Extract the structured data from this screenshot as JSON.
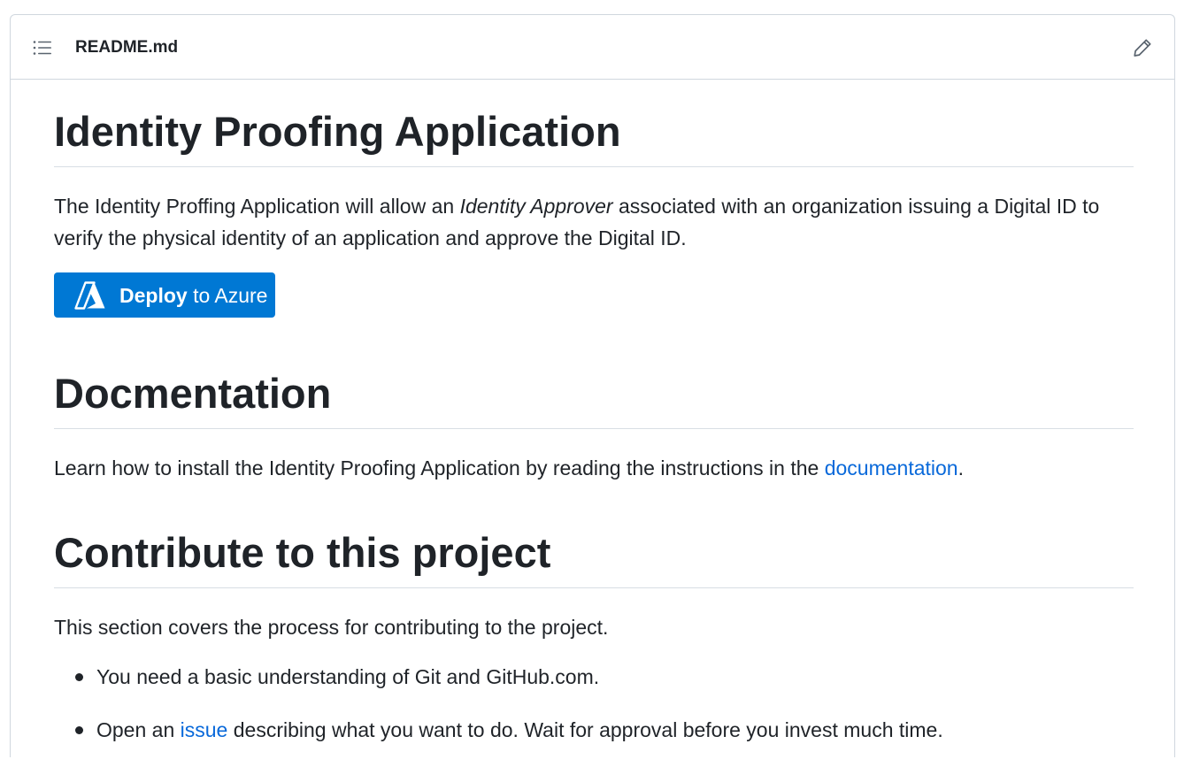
{
  "header": {
    "file_name": "README.md",
    "toc_icon": "list-unordered-icon",
    "edit_icon": "pencil-icon"
  },
  "content": {
    "title": "Identity Proofing Application",
    "intro": {
      "before": "The Identity Proffing Application will allow an ",
      "emphasis": "Identity Approver",
      "after": " associated with an organization issuing a Digital ID to verify the physical identity of an application and approve the Digital ID."
    },
    "deploy_button": {
      "strong": "Deploy",
      "rest": " to Azure",
      "icon": "azure-logo-icon",
      "background": "#0078d4"
    },
    "docs_heading": "Docmentation",
    "docs_paragraph": {
      "before": "Learn how to install the Identity Proofing Application by reading the instructions in the ",
      "link": "documentation",
      "after": "."
    },
    "contrib_heading": "Contribute to this project",
    "contrib_paragraph": "This section covers the process for contributing to the project.",
    "contrib_list": [
      {
        "text": "You need a basic understanding of Git and GitHub.com."
      },
      {
        "before": "Open an ",
        "link": "issue",
        "after": " describing what you want to do. Wait for approval before you invest much time."
      }
    ]
  },
  "colors": {
    "link": "#0969da",
    "text": "#1f2328",
    "border": "#d0d7de"
  }
}
